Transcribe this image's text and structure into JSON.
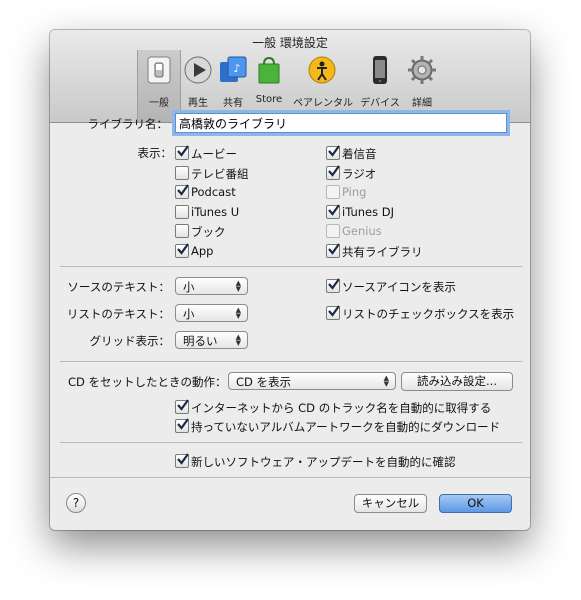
{
  "window": {
    "title": "一般 環境設定"
  },
  "toolbar": [
    {
      "label": "一般",
      "icon": "general-switch-icon"
    },
    {
      "label": "再生",
      "icon": "playback-icon"
    },
    {
      "label": "共有",
      "icon": "sharing-icon"
    },
    {
      "label": "Store",
      "icon": "store-bag-icon"
    },
    {
      "label": "ペアレンタル",
      "icon": "parental-icon"
    },
    {
      "label": "デバイス",
      "icon": "device-icon"
    },
    {
      "label": "詳細",
      "icon": "advanced-gear-icon"
    }
  ],
  "library": {
    "label": "ライブラリ名：",
    "value": "高橋敦のライブラリ"
  },
  "display": {
    "label": "表示：",
    "left": [
      {
        "label": "ムービー",
        "checked": true,
        "enabled": true
      },
      {
        "label": "テレビ番組",
        "checked": false,
        "enabled": true
      },
      {
        "label": "Podcast",
        "checked": true,
        "enabled": true
      },
      {
        "label": "iTunes U",
        "checked": false,
        "enabled": true
      },
      {
        "label": "ブック",
        "checked": false,
        "enabled": true
      },
      {
        "label": "App",
        "checked": true,
        "enabled": true
      }
    ],
    "right": [
      {
        "label": "着信音",
        "checked": true,
        "enabled": true
      },
      {
        "label": "ラジオ",
        "checked": true,
        "enabled": true
      },
      {
        "label": "Ping",
        "checked": false,
        "enabled": false
      },
      {
        "label": "iTunes DJ",
        "checked": true,
        "enabled": true
      },
      {
        "label": "Genius",
        "checked": false,
        "enabled": false
      },
      {
        "label": "共有ライブラリ",
        "checked": true,
        "enabled": true
      }
    ]
  },
  "text_options": {
    "source_text_label": "ソースのテキスト：",
    "source_text_value": "小",
    "list_text_label": "リストのテキスト：",
    "list_text_value": "小",
    "grid_label": "グリッド表示：",
    "grid_value": "明るい",
    "show_source_icons": "ソースアイコンを表示",
    "show_list_checkboxes": "リストのチェックボックスを表示"
  },
  "cd": {
    "label": "CD をセットしたときの動作：",
    "value": "CD を表示",
    "import_button": "読み込み設定...",
    "auto_track_names": "インターネットから CD のトラック名を自動的に取得する",
    "auto_artwork": "持っていないアルバムアートワークを自動的にダウンロード"
  },
  "updates": {
    "label": "新しいソフトウェア・アップデートを自動的に確認"
  },
  "footer": {
    "help": "?",
    "cancel": "キャンセル",
    "ok": "OK"
  },
  "colors": {
    "accent": "#5d99e6",
    "focus_ring": "#8fb6ea",
    "check": "#1b2a44"
  }
}
